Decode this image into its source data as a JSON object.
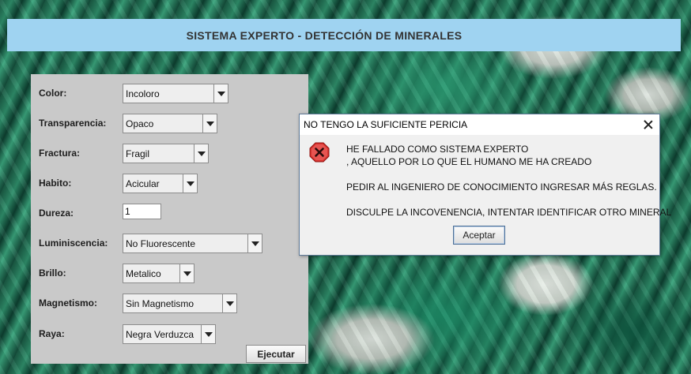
{
  "window": {
    "title": "SISTEMA EXPERTO - DETECCIÓN DE MINERALES"
  },
  "form": {
    "fields": [
      {
        "label": "Color:",
        "value": "Incoloro"
      },
      {
        "label": "Transparencia:",
        "value": "Opaco"
      },
      {
        "label": "Fractura:",
        "value": "Fragil"
      },
      {
        "label": "Habito:",
        "value": "Acicular"
      },
      {
        "label": "Dureza:",
        "value": "1"
      },
      {
        "label": "Luminiscencia:",
        "value": "No Fluorescente"
      },
      {
        "label": "Brillo:",
        "value": "Metalico"
      },
      {
        "label": "Magnetismo:",
        "value": "Sin Magnetismo"
      },
      {
        "label": "Raya:",
        "value": "Negra Verduzca"
      }
    ],
    "execute_label": "Ejecutar"
  },
  "dialog": {
    "title": "NO TENGO LA SUFICIENTE PERICIA",
    "icon": "error-icon",
    "lines": [
      "HE FALLADO COMO SISTEMA EXPERTO",
      ", AQUELLO POR LO QUE EL HUMANO ME HA CREADO",
      "PEDIR AL INGENIERO DE CONOCIMIENTO INGRESAR MÁS REGLAS.",
      "DISCULPE LA INCOVENENCIA, INTENTAR IDENTIFICAR OTRO MINERAL"
    ],
    "accept_label": "Aceptar"
  },
  "colors": {
    "title_bar": "#9fd3f1",
    "panel": "#c9c9c9",
    "error_red": "#d9322e"
  }
}
